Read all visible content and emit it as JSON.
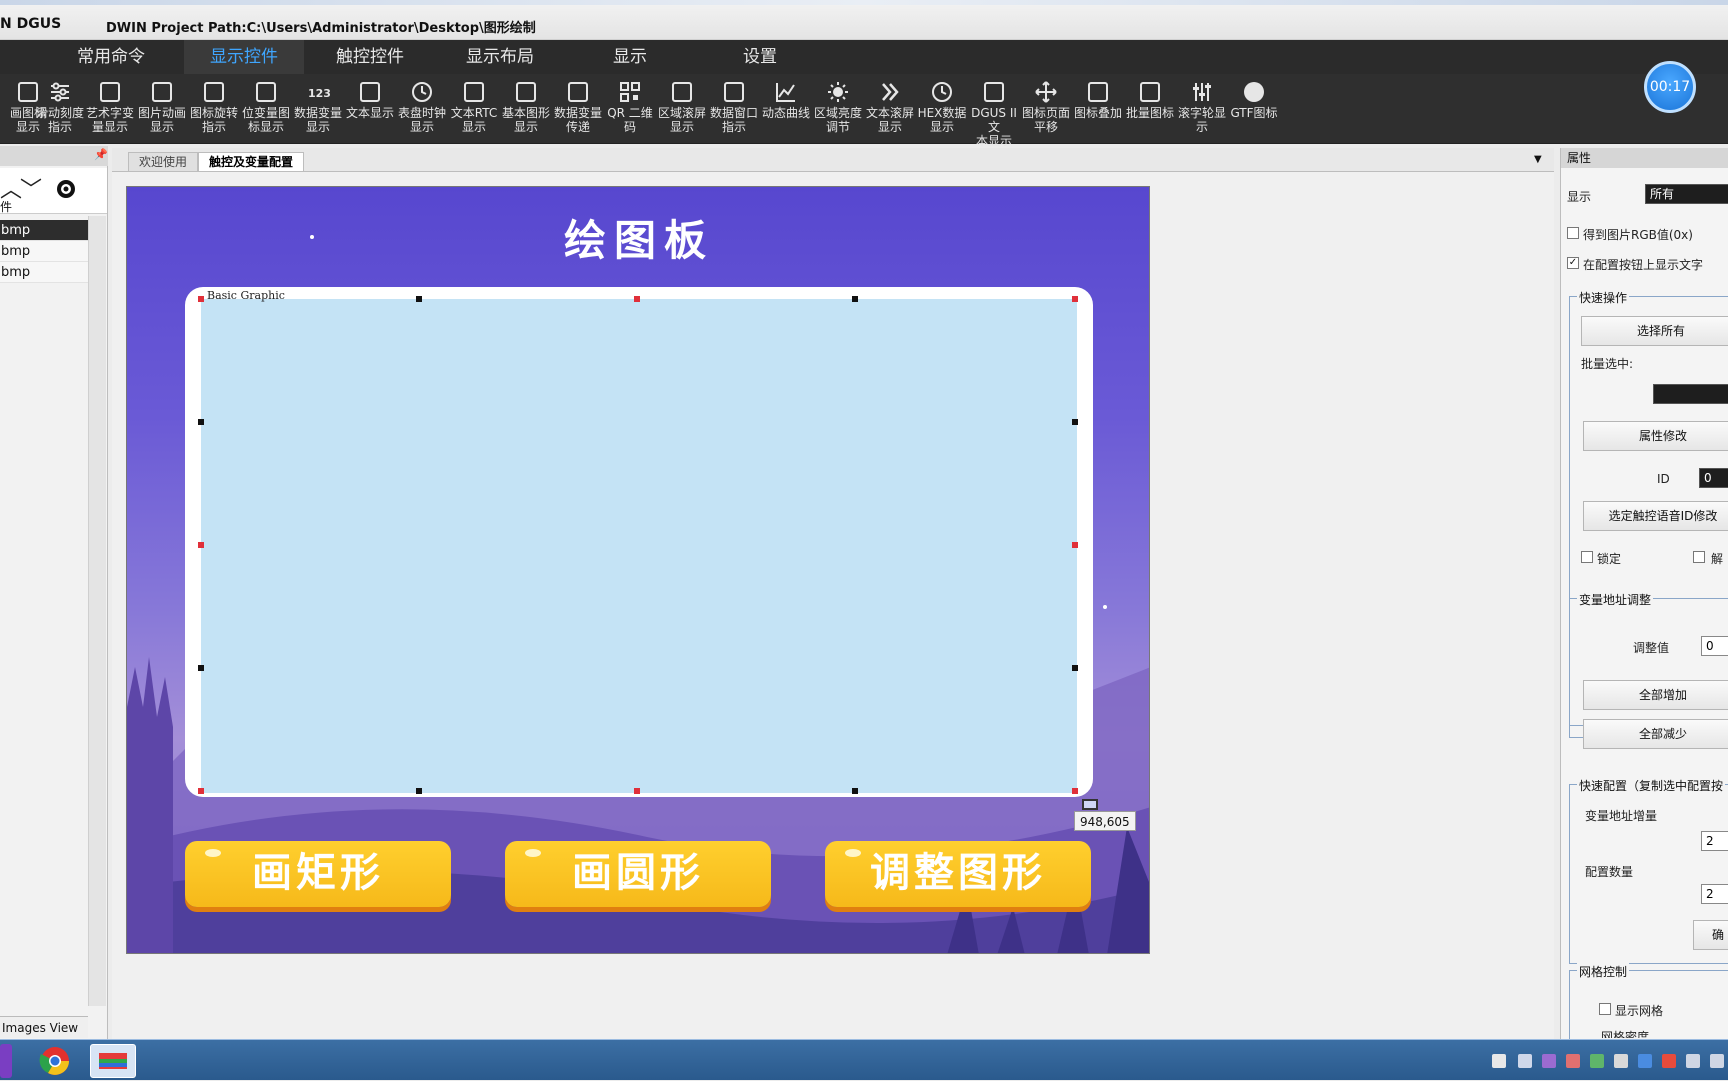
{
  "titlebar": {
    "app_name": "N DGUS",
    "project_path": "DWIN Project Path:C:\\Users\\Administrator\\Desktop\\图形绘制"
  },
  "menu": [
    "常用命令",
    "显示控件",
    "触控控件",
    "显示布局",
    "显示",
    "设置"
  ],
  "toolbar": [
    {
      "label": "画图标\n显示",
      "icon": "image-icon"
    },
    {
      "label": "滑动刻度\n指示",
      "icon": "slider-icon"
    },
    {
      "label": "艺术字变\n量显示",
      "icon": "art-text-icon"
    },
    {
      "label": "图片动画\n显示",
      "icon": "picture-animation-icon"
    },
    {
      "label": "图标旋转\n指示",
      "icon": "rotate-icon"
    },
    {
      "label": "位变量图\n标显示",
      "icon": "bit-variable-icon"
    },
    {
      "label": "数据变量\n显示",
      "icon": "number-123-icon"
    },
    {
      "label": "文本显示",
      "icon": "text-icon"
    },
    {
      "label": "表盘时钟\n显示",
      "icon": "clock-icon"
    },
    {
      "label": "文本RTC\n显示",
      "icon": "rtc-icon"
    },
    {
      "label": "基本图形\n显示",
      "icon": "shapes-icon"
    },
    {
      "label": "数据变量\n传递",
      "icon": "data-transfer-icon"
    },
    {
      "label": "QR 二维\n码",
      "icon": "qr-code-icon"
    },
    {
      "label": "区域滚屏\n显示",
      "icon": "scroll-area-icon"
    },
    {
      "label": "数据窗口\n指示",
      "icon": "data-window-icon"
    },
    {
      "label": "动态曲线",
      "icon": "curve-chart-icon"
    },
    {
      "label": "区域亮度\n调节",
      "icon": "brightness-icon"
    },
    {
      "label": "文本滚屏\n显示",
      "icon": "double-chevron-icon"
    },
    {
      "label": "HEX数据\n显示",
      "icon": "hex-clock-icon"
    },
    {
      "label": "DGUS II文\n本显示",
      "icon": "dgus-text-icon"
    },
    {
      "label": "图标页面\n平移",
      "icon": "move-arrows-icon"
    },
    {
      "label": "图标叠加",
      "icon": "overlay-icon"
    },
    {
      "label": "批量图标",
      "icon": "batch-icon"
    },
    {
      "label": "滚字轮显\n示",
      "icon": "wheel-sliders-icon"
    },
    {
      "label": "GTF图标",
      "icon": "gtf-circle-icon"
    }
  ],
  "timer": "00:17",
  "left_panel": {
    "header_pin": "ª",
    "section_label": "件",
    "files": [
      "bmp",
      "bmp",
      "bmp"
    ],
    "footer": "Images View"
  },
  "doc_tabs": [
    "欢迎使用",
    "触控及变量配置"
  ],
  "canvas": {
    "title": "绘图板",
    "object_label": "Basic Graphic",
    "buttons": [
      "画矩形",
      "画圆形",
      "调整图形"
    ],
    "coordinate_readout": "948,605"
  },
  "properties": {
    "header": "属性",
    "display_label": "显示",
    "display_value": "所有",
    "chk_rgb": "得到图片RGB值(0x)",
    "chk_show_text": "在配置按钮上显示文字",
    "quick_ops": "快速操作",
    "select_all": "选择所有",
    "batch_select": "批量选中:",
    "attr_modify": "属性修改",
    "id_label": "ID",
    "id_value": "0",
    "touch_voice": "选定触控语音ID修改",
    "lock": "锁定",
    "unlock": "解",
    "var_adjust": "变量地址调整",
    "adjust_value_label": "调整值",
    "adjust_value": "0",
    "all_inc": "全部增加",
    "all_dec": "全部减少",
    "quick_config": "快速配置（复制选中配置按",
    "var_increment": "变量地址增量",
    "var_increment_value": "2",
    "config_count": "配置数量",
    "config_count_value": "2",
    "confirm_btn": "确",
    "grid_control": "网格控制",
    "show_grid": "显示网格",
    "grid_partial": "网格密度"
  },
  "colors": {
    "accent": "#3fa6ff",
    "board_blue": "#c4e3f5",
    "button_yellow": "#ffc62a"
  }
}
